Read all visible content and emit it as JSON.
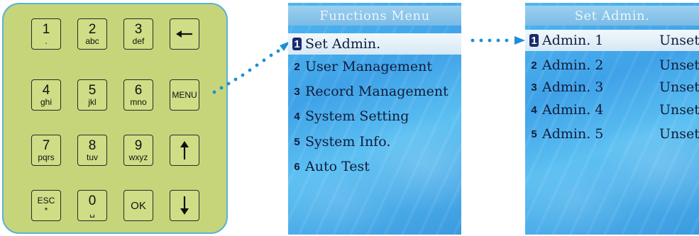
{
  "keypad": {
    "keys": [
      {
        "main": "1",
        "sub": "."
      },
      {
        "main": "2",
        "sub": "abc"
      },
      {
        "main": "3",
        "sub": "def"
      },
      {
        "main": "4",
        "sub": "ghi"
      },
      {
        "main": "5",
        "sub": "jkl"
      },
      {
        "main": "6",
        "sub": "mno"
      },
      {
        "main": "7",
        "sub": "pqrs"
      },
      {
        "main": "8",
        "sub": "tuv"
      },
      {
        "main": "9",
        "sub": "wxyz"
      },
      {
        "main": "ESC",
        "sub": "*"
      },
      {
        "main": "0",
        "sub": "␣"
      },
      {
        "main": "OK"
      },
      {
        "main": "MENU"
      }
    ],
    "icons": [
      "backspace-arrow-icon",
      "arrow-up-icon",
      "arrow-down-icon"
    ],
    "key_color": "#cfdd86",
    "panel_color": "#c6d57a",
    "border_color": "#5fb0d8"
  },
  "functions_menu": {
    "title": "Functions Menu",
    "items": [
      {
        "num": "1",
        "label": "Set Admin."
      },
      {
        "num": "2",
        "label": "User Management"
      },
      {
        "num": "3",
        "label": "Record Management"
      },
      {
        "num": "4",
        "label": "System Setting"
      },
      {
        "num": "5",
        "label": "System Info."
      },
      {
        "num": "6",
        "label": "Auto Test"
      }
    ]
  },
  "set_admin": {
    "title": "Set Admin.",
    "items": [
      {
        "num": "1",
        "label": "Admin. 1",
        "value": "Unset"
      },
      {
        "num": "2",
        "label": "Admin. 2",
        "value": "Unset"
      },
      {
        "num": "3",
        "label": "Admin. 3",
        "value": "Unset"
      },
      {
        "num": "4",
        "label": "Admin. 4",
        "value": "Unset"
      },
      {
        "num": "5",
        "label": "Admin. 5",
        "value": "Unset"
      }
    ]
  },
  "colors": {
    "connector": "#1d8fd6",
    "selected_badge": "#1a2a6e"
  }
}
